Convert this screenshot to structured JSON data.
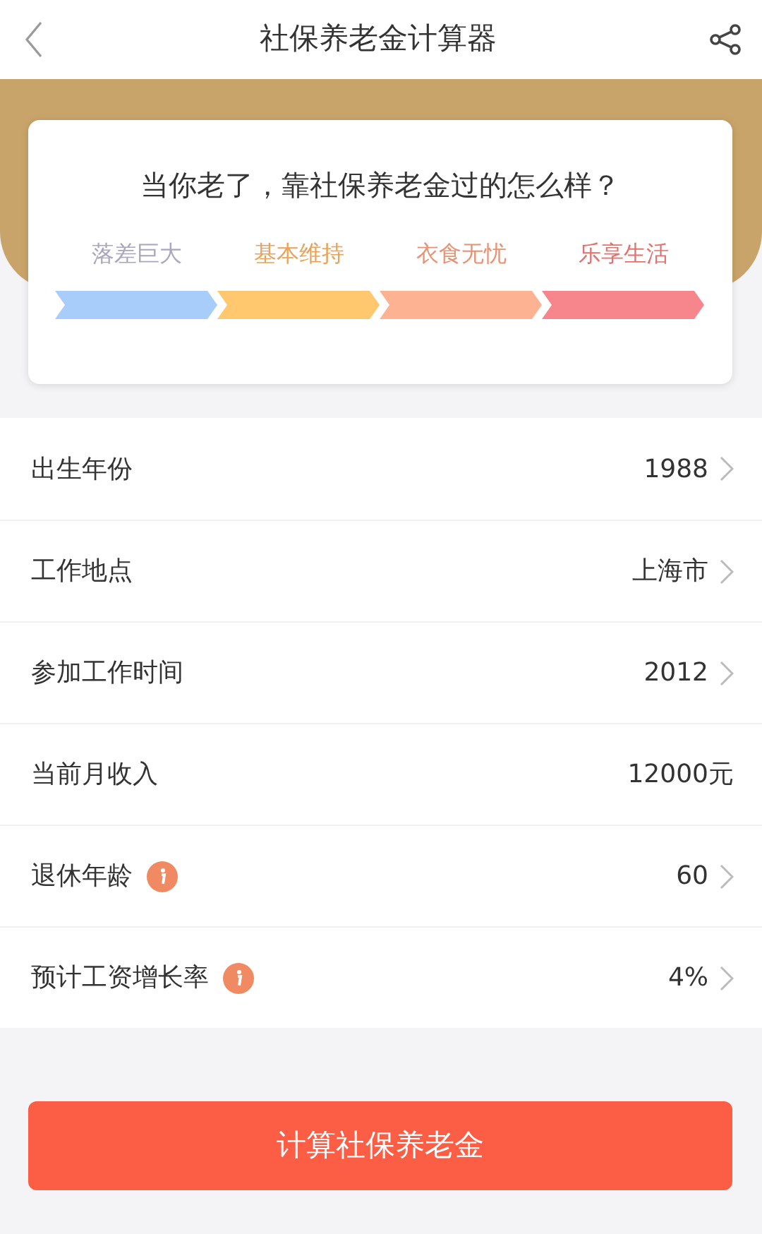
{
  "header": {
    "title": "社保养老金计算器"
  },
  "banner": {
    "question": "当你老了，靠社保养老金过的怎么样？",
    "levels": [
      {
        "label": "落差巨大",
        "color": "#a8cdfa"
      },
      {
        "label": "基本维持",
        "color": "#ffc86e"
      },
      {
        "label": "衣食无忧",
        "color": "#fdb292"
      },
      {
        "label": "乐享生活",
        "color": "#f7868c"
      }
    ]
  },
  "form": [
    {
      "label": "出生年份",
      "value": "1988",
      "info": false,
      "chevron": true
    },
    {
      "label": "工作地点",
      "value": "上海市",
      "info": false,
      "chevron": true
    },
    {
      "label": "参加工作时间",
      "value": "2012",
      "info": false,
      "chevron": true
    },
    {
      "label": "当前月收入",
      "value": "12000元",
      "info": false,
      "chevron": false
    },
    {
      "label": "退休年龄",
      "value": "60",
      "info": true,
      "chevron": true
    },
    {
      "label": "预计工资增长率",
      "value": "4%",
      "info": true,
      "chevron": true
    }
  ],
  "submit": {
    "label": "计算社保养老金"
  }
}
